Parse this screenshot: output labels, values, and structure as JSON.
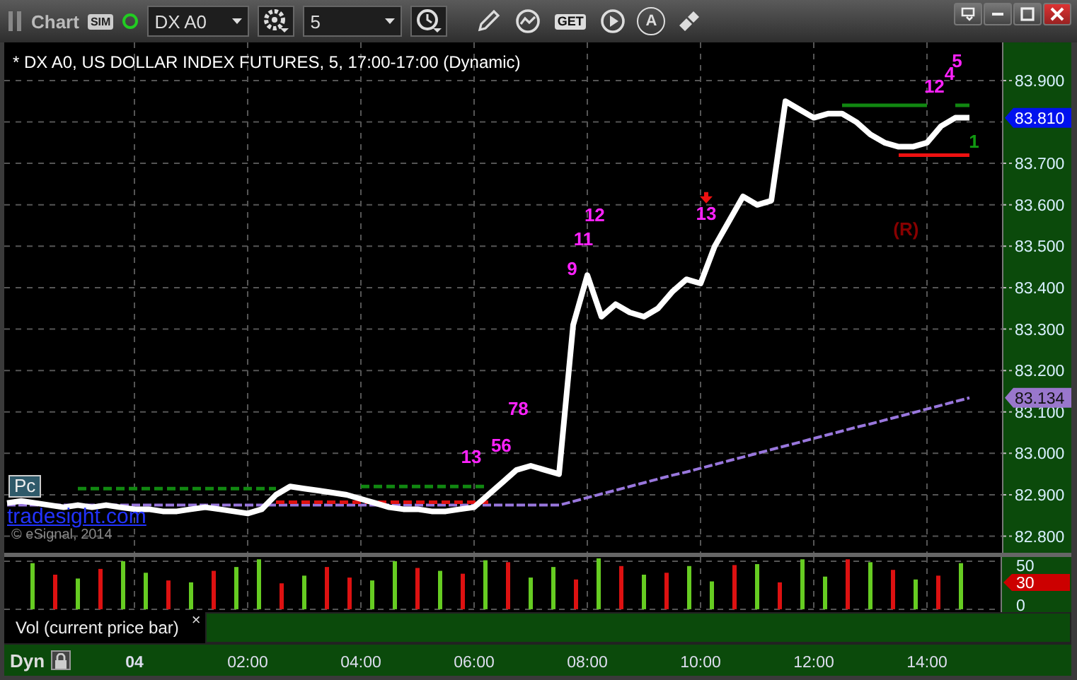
{
  "window": {
    "title": "Chart",
    "sim_badge": "SIM",
    "connected": true,
    "symbol": "DX A0",
    "interval": "5",
    "get_button": "GET",
    "alert_button": "A"
  },
  "price_chart": {
    "title": "* DX A0, US DOLLAR INDEX FUTURES, 5, 17:00-17:00 (Dynamic)",
    "logo_box": "Pc",
    "link": "tradesight.com",
    "copyright": "© eSignal, 2014",
    "last_price": "83.810",
    "average_price": "83.134",
    "chart_data": {
      "type": "line",
      "grid": true,
      "xlim": [
        -2.3,
        16.55
      ],
      "ylim": [
        82.76,
        83.992
      ],
      "x": [
        -2.25,
        -2,
        -1.75,
        -1.5,
        -1.25,
        -1,
        -0.75,
        -0.5,
        -0.25,
        0,
        0.25,
        0.5,
        0.75,
        1,
        1.25,
        1.5,
        1.75,
        2,
        2.25,
        2.5,
        2.75,
        3,
        3.25,
        3.5,
        3.75,
        4,
        4.25,
        4.5,
        4.75,
        5,
        5.25,
        5.5,
        5.75,
        6,
        6.25,
        6.5,
        6.75,
        7,
        7.25,
        7.5,
        7.75,
        8,
        8.25,
        8.5,
        8.75,
        9,
        9.25,
        9.5,
        9.75,
        10,
        10.25,
        10.5,
        10.75,
        11,
        11.25,
        11.5,
        11.75,
        12,
        12.25,
        12.5,
        12.75,
        13,
        13.25,
        13.5,
        13.75,
        14,
        14.25,
        14.5,
        14.75
      ],
      "series": [
        {
          "color": "#ffffff",
          "line_style": "solid",
          "values": [
            82.88,
            82.885,
            82.88,
            82.875,
            82.87,
            82.875,
            82.87,
            82.875,
            82.87,
            82.865,
            82.865,
            82.86,
            82.86,
            82.865,
            82.87,
            82.865,
            82.86,
            82.855,
            82.865,
            82.9,
            82.92,
            82.915,
            82.91,
            82.905,
            82.9,
            82.89,
            82.88,
            82.87,
            82.865,
            82.865,
            82.86,
            82.86,
            82.865,
            82.87,
            82.9,
            82.93,
            82.96,
            82.97,
            82.96,
            82.95,
            83.31,
            83.43,
            83.33,
            83.36,
            83.34,
            83.33,
            83.35,
            83.39,
            83.42,
            83.41,
            83.5,
            83.56,
            83.62,
            83.6,
            83.61,
            83.85,
            83.83,
            83.81,
            83.82,
            83.82,
            83.8,
            83.77,
            83.75,
            83.74,
            83.74,
            83.75,
            83.79,
            83.81,
            83.81
          ]
        },
        {
          "color": "#9977dd",
          "line_style": "dashed",
          "values": [
            82.875,
            82.875,
            82.875,
            82.875,
            82.875,
            82.875,
            82.875,
            82.875,
            82.875,
            82.875,
            82.875,
            82.875,
            82.875,
            82.875,
            82.875,
            82.875,
            82.875,
            82.875,
            82.875,
            82.875,
            82.875,
            82.875,
            82.875,
            82.875,
            82.875,
            82.875,
            82.875,
            82.875,
            82.875,
            82.875,
            82.875,
            82.875,
            82.875,
            82.875,
            82.875,
            82.875,
            82.875,
            82.875,
            82.875,
            82.875,
            82.884,
            82.893,
            82.902,
            82.911,
            82.92,
            82.929,
            82.938,
            82.947,
            82.955,
            82.964,
            82.973,
            82.982,
            82.991,
            83.0,
            83.009,
            83.018,
            83.027,
            83.036,
            83.045,
            83.054,
            83.063,
            83.071,
            83.08,
            83.089,
            83.098,
            83.107,
            83.116,
            83.125,
            83.134
          ]
        },
        {
          "color": "#118811",
          "line_style": "dashed",
          "values": [
            null,
            null,
            null,
            null,
            null,
            82.915,
            82.915,
            82.915,
            82.915,
            82.915,
            82.915,
            82.915,
            82.915,
            82.915,
            82.915,
            82.915,
            82.915,
            82.915,
            82.915,
            82.915,
            null,
            null,
            null,
            null,
            null,
            null,
            null,
            null,
            null,
            null,
            null,
            null,
            null,
            null,
            null,
            null,
            null,
            null,
            null,
            null,
            null,
            null,
            null,
            null,
            null,
            null,
            null,
            null,
            null,
            null,
            null,
            null,
            null,
            null,
            null,
            null,
            null,
            null,
            null,
            null,
            null,
            null,
            null,
            null,
            null,
            null,
            null,
            null,
            null
          ]
        },
        {
          "color": "#118811",
          "line_style": "dashed",
          "values": [
            null,
            null,
            null,
            null,
            null,
            null,
            null,
            null,
            null,
            null,
            null,
            null,
            null,
            null,
            null,
            null,
            null,
            null,
            null,
            null,
            null,
            null,
            null,
            null,
            null,
            82.92,
            82.92,
            82.92,
            82.92,
            82.92,
            82.92,
            82.92,
            82.92,
            82.92,
            82.92,
            null,
            null,
            null,
            null,
            null,
            null,
            null,
            null,
            null,
            null,
            null,
            null,
            null,
            null,
            null,
            null,
            null,
            null,
            null,
            null,
            null,
            null,
            null,
            null,
            null,
            null,
            null,
            null,
            null,
            null,
            null,
            null,
            null,
            null
          ]
        },
        {
          "color": "#dd1111",
          "line_style": "dashed",
          "values": [
            null,
            null,
            null,
            null,
            null,
            null,
            null,
            null,
            null,
            null,
            null,
            null,
            null,
            null,
            null,
            null,
            null,
            null,
            null,
            82.882,
            82.882,
            82.882,
            82.882,
            82.882,
            82.882,
            82.882,
            82.882,
            82.882,
            82.882,
            82.882,
            82.882,
            82.882,
            82.882,
            82.882,
            82.882,
            null,
            null,
            null,
            null,
            null,
            null,
            null,
            null,
            null,
            null,
            null,
            null,
            null,
            null,
            null,
            null,
            null,
            null,
            null,
            null,
            null,
            null,
            null,
            null,
            null,
            null,
            null,
            null,
            null,
            null,
            null,
            null,
            null,
            null
          ]
        },
        {
          "color": "#118811",
          "line_style": "solid",
          "values": [
            null,
            null,
            null,
            null,
            null,
            null,
            null,
            null,
            null,
            null,
            null,
            null,
            null,
            null,
            null,
            null,
            null,
            null,
            null,
            null,
            null,
            null,
            null,
            null,
            null,
            null,
            null,
            null,
            null,
            null,
            null,
            null,
            null,
            null,
            null,
            null,
            null,
            null,
            null,
            null,
            null,
            null,
            null,
            null,
            null,
            null,
            null,
            null,
            null,
            null,
            null,
            null,
            null,
            null,
            null,
            null,
            null,
            null,
            null,
            83.84,
            83.84,
            83.84,
            83.84,
            83.84,
            83.84,
            83.84,
            null,
            83.84,
            83.84
          ]
        },
        {
          "color": "#ee1111",
          "line_style": "solid",
          "values": [
            null,
            null,
            null,
            null,
            null,
            null,
            null,
            null,
            null,
            null,
            null,
            null,
            null,
            null,
            null,
            null,
            null,
            null,
            null,
            null,
            null,
            null,
            null,
            null,
            null,
            null,
            null,
            null,
            null,
            null,
            null,
            null,
            null,
            null,
            null,
            null,
            null,
            null,
            null,
            null,
            null,
            null,
            null,
            null,
            null,
            null,
            null,
            null,
            null,
            null,
            null,
            null,
            null,
            null,
            null,
            null,
            null,
            null,
            null,
            null,
            null,
            null,
            null,
            83.72,
            83.72,
            83.72,
            83.72,
            83.72,
            83.72
          ]
        }
      ],
      "yticks": [
        {
          "value": 82.8,
          "label": "82.800"
        },
        {
          "value": 82.9,
          "label": "82.900"
        },
        {
          "value": 83.0,
          "label": "83.000"
        },
        {
          "value": 83.1,
          "label": "83.100"
        },
        {
          "value": 83.2,
          "label": "83.200"
        },
        {
          "value": 83.3,
          "label": "83.300"
        },
        {
          "value": 83.4,
          "label": "83.400"
        },
        {
          "value": 83.5,
          "label": "83.500"
        },
        {
          "value": 83.6,
          "label": "83.600"
        },
        {
          "value": 83.7,
          "label": "83.700"
        },
        {
          "value": 83.9,
          "label": "83.900"
        }
      ],
      "annotations": [
        "9",
        "11",
        "12",
        "13",
        "13",
        "56",
        "78",
        "12",
        "4",
        "5",
        "(R)",
        "1"
      ]
    },
    "signals": [
      {
        "color": "#ff22ff",
        "arrow": false
      },
      {
        "color": "#ff22ff",
        "arrow": false
      },
      {
        "color": "#ff22ff",
        "arrow": false
      },
      {
        "color": "#ff22ff",
        "arrow": true
      },
      {
        "color": "#ff22ff",
        "arrow": false
      },
      {
        "color": "#ff22ff",
        "arrow": false
      },
      {
        "color": "#ff22ff",
        "arrow": false
      },
      {
        "color": "#ff22ff",
        "arrow": false
      },
      {
        "color": "#ff22ff",
        "arrow": false
      },
      {
        "color": "#ff22ff",
        "arrow": false
      },
      {
        "color": "#880000",
        "arrow": false
      },
      {
        "color": "#119911",
        "arrow": false
      }
    ]
  },
  "volume": {
    "label": "Vol (current price bar)",
    "close": "×",
    "last_value": "30",
    "chart_data": {
      "type": "bar",
      "grid": true,
      "xlim": [
        -2.3,
        16.55
      ],
      "ylim": [
        -3,
        54.4
      ],
      "x": [
        -1.8,
        -1.4,
        -1,
        -0.6,
        -0.2,
        0.2,
        0.6,
        1,
        1.4,
        1.8,
        2.2,
        2.6,
        3,
        3.4,
        3.8,
        4.2,
        4.6,
        5,
        5.4,
        5.8,
        6.2,
        6.6,
        7,
        7.4,
        7.8,
        8.2,
        8.6,
        9,
        9.4,
        9.8,
        10.2,
        10.6,
        11,
        11.4,
        11.8,
        12.2,
        12.6,
        13,
        13.4,
        13.8,
        14.2,
        14.6
      ],
      "series": [
        {
          "color": "#66cc22",
          "values": [
            48,
            null,
            32,
            null,
            50,
            38,
            null,
            28,
            null,
            44,
            52,
            null,
            35,
            null,
            null,
            30,
            50,
            null,
            40,
            null,
            51,
            null,
            33,
            44,
            null,
            53,
            null,
            36,
            null,
            45,
            29,
            null,
            47,
            null,
            52,
            34,
            null,
            49,
            null,
            31,
            null,
            48
          ]
        },
        {
          "color": "#dd1111",
          "values": [
            null,
            36,
            null,
            42,
            null,
            null,
            30,
            null,
            40,
            null,
            null,
            27,
            null,
            44,
            33,
            null,
            null,
            43,
            null,
            37,
            null,
            49,
            null,
            null,
            31,
            null,
            45,
            null,
            38,
            null,
            null,
            46,
            null,
            28,
            null,
            null,
            52,
            null,
            41,
            null,
            35,
            null
          ]
        }
      ],
      "xticks": [
        {
          "value": 2,
          "label": "02:00"
        },
        {
          "value": 4,
          "label": "04:00"
        },
        {
          "value": 6,
          "label": "06:00"
        },
        {
          "value": 8,
          "label": "08:00"
        },
        {
          "value": 10,
          "label": "10:00"
        },
        {
          "value": 12,
          "label": "12:00"
        },
        {
          "value": 14,
          "label": "14:00"
        }
      ],
      "yticks": [
        0,
        50
      ]
    }
  },
  "time_axis": {
    "mode": "Dyn",
    "date": "04"
  }
}
